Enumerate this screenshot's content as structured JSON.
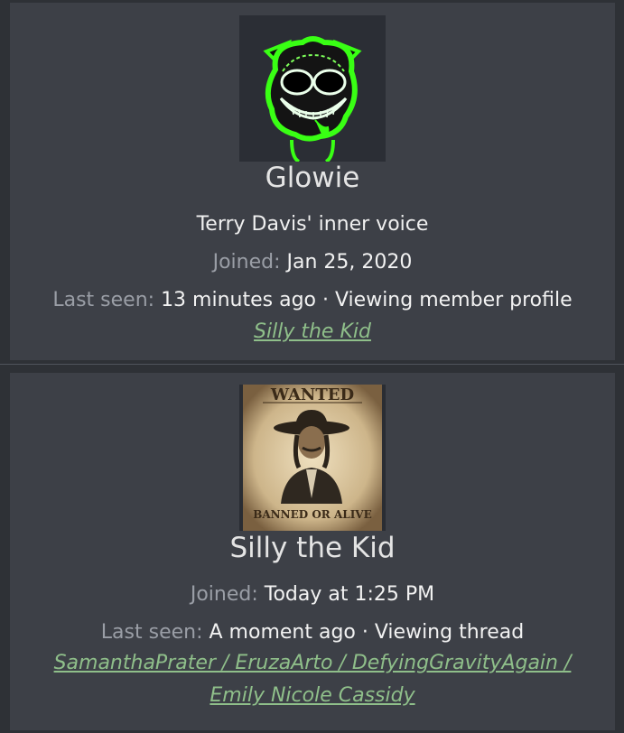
{
  "members": [
    {
      "name": "Glowie",
      "user_title": "Terry Davis' inner voice",
      "joined_label": "Joined:",
      "joined_value": "Jan 25, 2020",
      "last_seen_label": "Last seen:",
      "last_seen_value": "13 minutes ago · Viewing member profile",
      "activity_link": "Silly the Kid"
    },
    {
      "name": "Silly the Kid",
      "joined_label": "Joined:",
      "joined_value": "Today at 1:25 PM",
      "last_seen_label": "Last seen:",
      "last_seen_value": "A moment ago · Viewing thread",
      "activity_link_line1": "SamanthaPrater / EruzaArto / DefyingGravityAgain /",
      "activity_link_line2": "Emily Nicole Cassidy",
      "avatar_text_top": "WANTED",
      "avatar_text_bottom": "BANNED OR ALIVE"
    }
  ]
}
